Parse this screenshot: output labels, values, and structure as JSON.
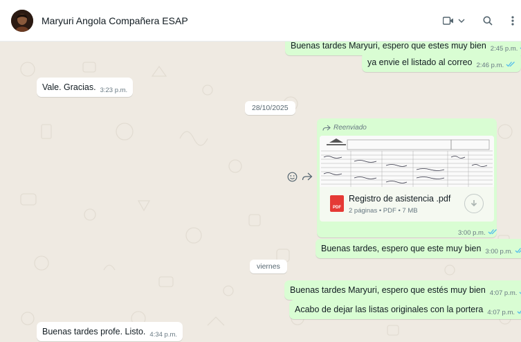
{
  "header": {
    "contact_name": "Maryuri Angola Compañera ESAP",
    "icons": [
      "video-call-icon",
      "chevron-down-icon",
      "search-icon",
      "menu-icon"
    ]
  },
  "messages": [
    {
      "dir": "out",
      "text": "Buenas tardes Maryuri, espero que estes muy bien",
      "time": "2:45 p.m.",
      "status": "read"
    },
    {
      "dir": "out",
      "text": "ya envie el listado al correo",
      "time": "2:46 p.m.",
      "status": "read"
    },
    {
      "dir": "in",
      "text": "Vale. Gracias.",
      "time": "3:23 p.m."
    },
    {
      "dir": "out",
      "text": "Buenas tardes, espero que este muy bien",
      "time": "3:00 p.m.",
      "status": "read"
    },
    {
      "dir": "out",
      "text": "Buenas tardes Maryuri, espero que estés muy bien",
      "time": "4:07 p.m.",
      "status": "read"
    },
    {
      "dir": "out",
      "text": "Acabo de dejar las listas originales con la portera",
      "time": "4:07 p.m.",
      "status": "read"
    },
    {
      "dir": "in",
      "text": "Buenas tardes profe. Listo.",
      "time": "4:34 p.m."
    }
  ],
  "dates": {
    "first": "28/10/2025",
    "second": "viernes"
  },
  "document": {
    "forwarded_label": "Reenviado",
    "name": "Registro de asistencia .pdf",
    "meta": "2 páginas • PDF • 7 MB",
    "badge": "PDF",
    "time": "3:00 p.m.",
    "status": "read"
  },
  "colors": {
    "outgoing": "#d9fdd3",
    "incoming": "#ffffff",
    "background": "#efeae2",
    "read_ticks": "#53bdeb"
  }
}
